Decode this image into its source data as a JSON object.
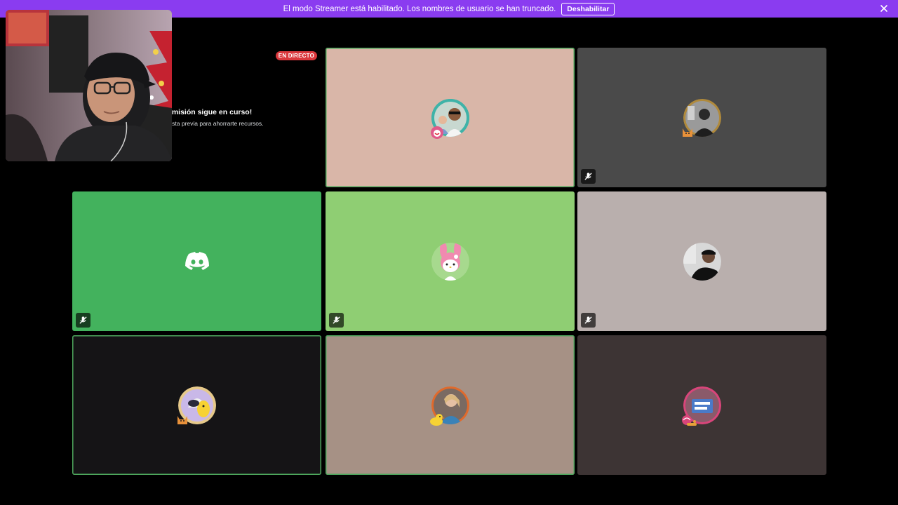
{
  "banner": {
    "message": "El modo Streamer está habilitado. Los nombres de usuario se han truncado.",
    "button_label": "Deshabilitar",
    "background": "#8a3cf0"
  },
  "stream": {
    "live_label": "EN DIRECTO",
    "title": "smisión sigue en curso!",
    "subtitle": "vista previa para ahorrarte recursos."
  },
  "tiles": [
    {
      "color": "#d9b6a8",
      "speaking": true,
      "muted": false
    },
    {
      "color": "#4a4a4a",
      "speaking": false,
      "muted": true
    },
    {
      "color": "#43b25d",
      "speaking": false,
      "muted": true
    },
    {
      "color": "#8fce73",
      "speaking": false,
      "muted": true
    },
    {
      "color": "#b9afad",
      "speaking": false,
      "muted": true
    },
    {
      "color": "#151416",
      "speaking": true,
      "muted": false
    },
    {
      "color": "#a69185",
      "speaking": true,
      "muted": false
    },
    {
      "color": "#3d3434",
      "speaking": false,
      "muted": false
    }
  ],
  "icons": {
    "close": "close-icon",
    "mute": "mic-off-icon",
    "discord": "discord-logo-icon"
  }
}
